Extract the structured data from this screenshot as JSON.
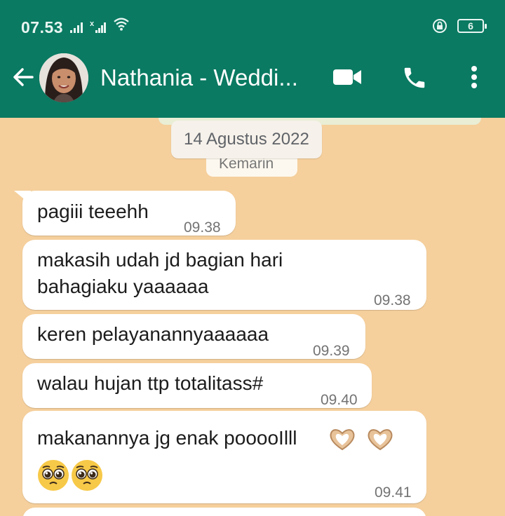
{
  "status_bar": {
    "time": "07.53",
    "battery": "6"
  },
  "chat_header": {
    "contact_name": "Nathania - Weddi..."
  },
  "date_chip": "14 Agustus 2022",
  "ghost_message": "Kemarin",
  "messages": [
    {
      "text": "pagiii teeehh",
      "time": "09.38"
    },
    {
      "line1": "makasih udah jd bagian hari",
      "line2": "bahagiaku yaaaaaa",
      "time": "09.38"
    },
    {
      "text": "keren pelayanannyaaaaaa",
      "time": "09.39"
    },
    {
      "text": "walau hujan ttp totalitass#",
      "time": "09.40"
    },
    {
      "text": "makanannya jg enak pooooIlll",
      "time": "09.41",
      "emojis": [
        "heart-hands-emoji",
        "heart-hands-emoji",
        "pleading-face-emoji",
        "pleading-face-emoji"
      ]
    }
  ],
  "colors": {
    "header": "#0a7a62",
    "chat_background": "#f5cf9c",
    "bubble": "#ffffff"
  }
}
